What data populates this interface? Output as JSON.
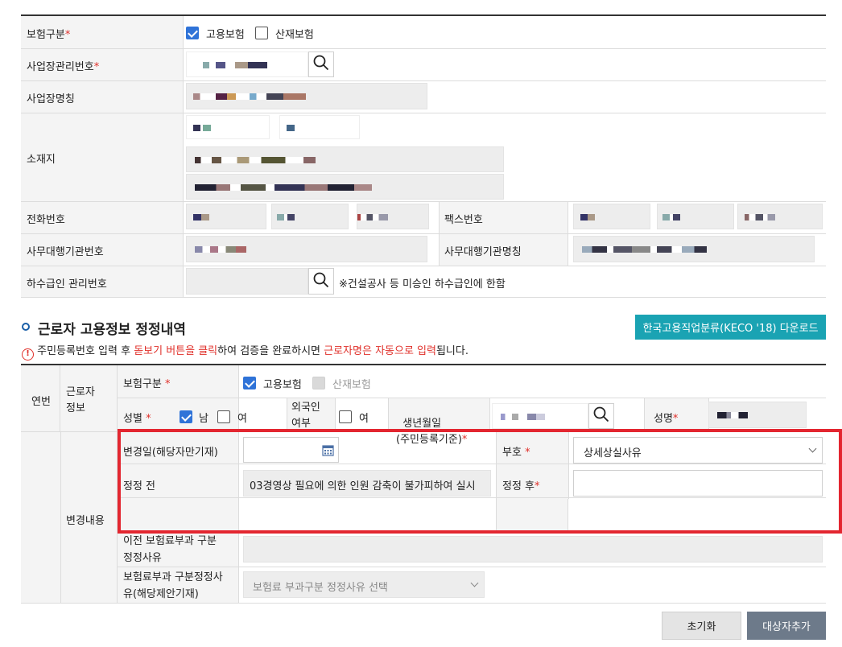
{
  "form": {
    "insurance_type_label": "보험구분",
    "req_mark": "*",
    "employment_insurance": "고용보험",
    "industrial_insurance": "산재보험",
    "business_no_label": "사업장관리번호",
    "business_name_label": "사업장명칭",
    "address_label": "소재지",
    "phone_label": "전화번호",
    "fax_label": "팩스번호",
    "agency_no_label": "사무대행기관번호",
    "agency_name_label": "사무대행기관명칭",
    "subcontract_label": "하수급인 관리번호",
    "subcontract_note": "※건설공사 등 미승인 하수급인에 한함"
  },
  "section": {
    "title": "근로자 고용정보 정정내역",
    "download_button": "한국고용직업분류(KECO '18) 다운로드",
    "notice_prefix": "주민등록번호 입력 후 ",
    "notice_hl1": "돋보기 버튼을 클릭",
    "notice_mid": "하여 검증을 완료하시면 ",
    "notice_hl2": "근로자명은 자동으로 입력",
    "notice_suffix": "됩니다."
  },
  "worker": {
    "seq_label": "연번",
    "info_label": "근로자\n정보",
    "insurance_type_label": "보험구분",
    "employment_insurance": "고용보험",
    "industrial_insurance": "산재보험",
    "gender_label": "성별",
    "male": "남",
    "female": "여",
    "foreigner_label": "외국인\n여부",
    "foreigner_female": "여",
    "birth_label": "생년월일\n(주민등록기준)",
    "name_label": "성명"
  },
  "change": {
    "section_label": "변경내용",
    "change_date_label": "변경일(해당자만기재)",
    "code_label": "부호",
    "code_value": "상세상실사유",
    "before_label": "정정 전",
    "before_value": "03경영상 필요에 의한 인원 감축이 불가피하여 실시",
    "after_label": "정정 후",
    "after_value": "",
    "prev_reason_label": "이전 보험료부과 구분\n정정사유",
    "reason_label": "보험료부과 구분정정사\n유(해당제안기재)",
    "reason_placeholder": "보험료 부과구분 정정사유 선택"
  },
  "buttons": {
    "reset": "초기화",
    "add_target": "대상자추가"
  },
  "colors": {
    "accent_teal": "#1aa3b3",
    "primary_check": "#2f73d8",
    "highlight_red": "#e0302a",
    "button_dark": "#6d7a8a"
  }
}
